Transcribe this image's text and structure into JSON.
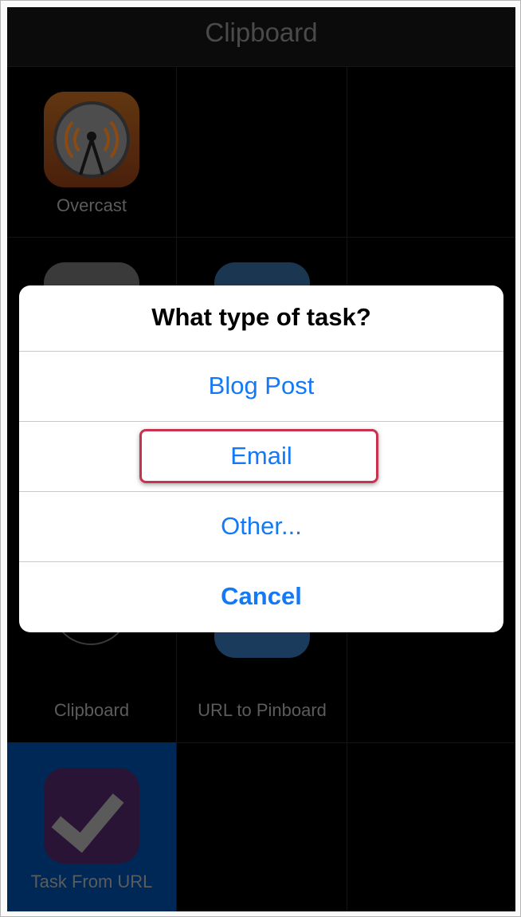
{
  "screen": {
    "title": "Clipboard"
  },
  "actions": [
    {
      "label": "Overcast",
      "icon": "overcast-broadcast-icon"
    },
    {
      "label": "Clipboard",
      "icon": "clipboard-document-icon"
    },
    {
      "label": "URL to Pinboard",
      "icon": "pushpin-icon"
    },
    {
      "label": "Task From URL",
      "icon": "checkmark-icon"
    }
  ],
  "dialog": {
    "title": "What type of task?",
    "options": [
      {
        "label": "Blog Post"
      },
      {
        "label": "Email"
      },
      {
        "label": "Other..."
      },
      {
        "label": "Cancel"
      }
    ]
  },
  "colors": {
    "accent": "#1479f5",
    "highlight": "#c8324f",
    "selected_cell": "#002856"
  }
}
